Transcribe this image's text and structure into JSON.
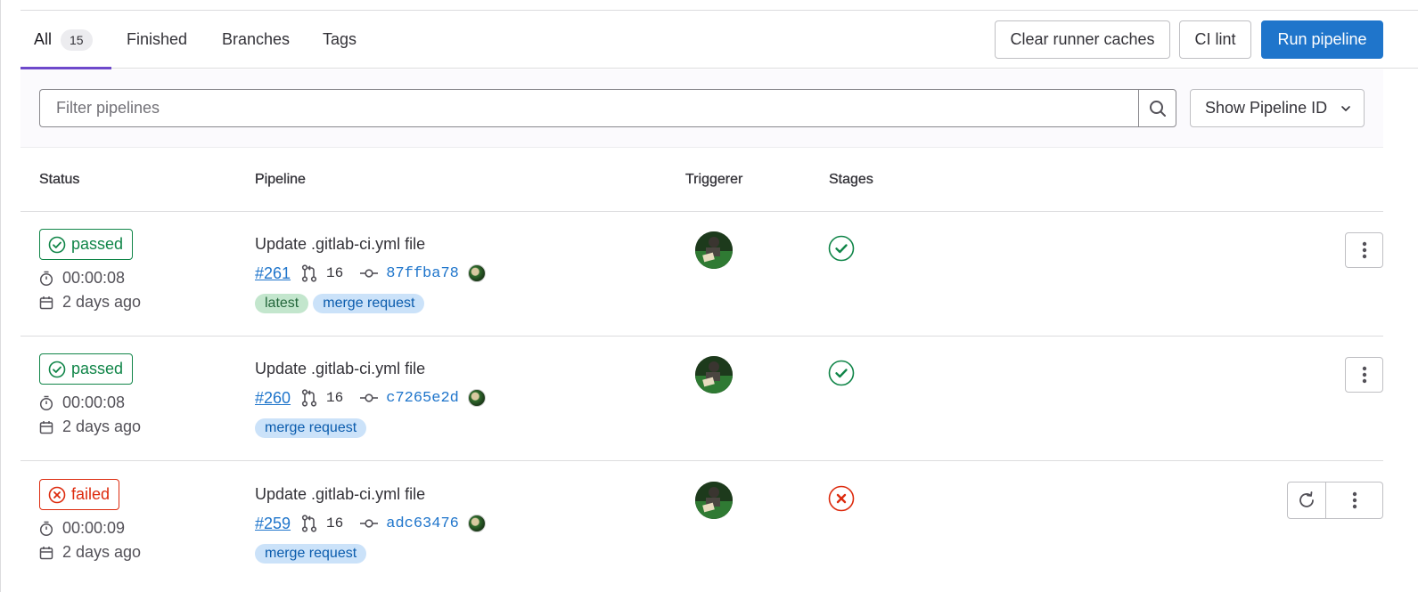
{
  "tabs": [
    {
      "label": "All",
      "count": "15",
      "active": true
    },
    {
      "label": "Finished"
    },
    {
      "label": "Branches"
    },
    {
      "label": "Tags"
    }
  ],
  "actions": {
    "clear_runner_caches": "Clear runner caches",
    "ci_lint": "CI lint",
    "run_pipeline": "Run pipeline"
  },
  "filter": {
    "placeholder": "Filter pipelines",
    "value": "",
    "show_option": "Show Pipeline ID"
  },
  "columns": {
    "status": "Status",
    "pipeline": "Pipeline",
    "triggerer": "Triggerer",
    "stages": "Stages"
  },
  "rows": [
    {
      "status": "passed",
      "duration": "00:00:08",
      "finished": "2 days ago",
      "title": "Update .gitlab-ci.yml file",
      "pipeline_id": "#261",
      "mr_count": "16",
      "sha": "87ffba78",
      "badges": [
        "latest",
        "merge request"
      ],
      "stage_status": "success"
    },
    {
      "status": "passed",
      "duration": "00:00:08",
      "finished": "2 days ago",
      "title": "Update .gitlab-ci.yml file",
      "pipeline_id": "#260",
      "mr_count": "16",
      "sha": "c7265e2d",
      "badges": [
        "merge request"
      ],
      "stage_status": "success"
    },
    {
      "status": "failed",
      "duration": "00:00:09",
      "finished": "2 days ago",
      "title": "Update .gitlab-ci.yml file",
      "pipeline_id": "#259",
      "mr_count": "16",
      "sha": "adc63476",
      "badges": [
        "merge request"
      ],
      "stage_status": "failed"
    }
  ],
  "colors": {
    "accent": "#1f75cb",
    "success": "#108548",
    "danger": "#dd2b0e",
    "tab_active": "#6e49cb"
  }
}
